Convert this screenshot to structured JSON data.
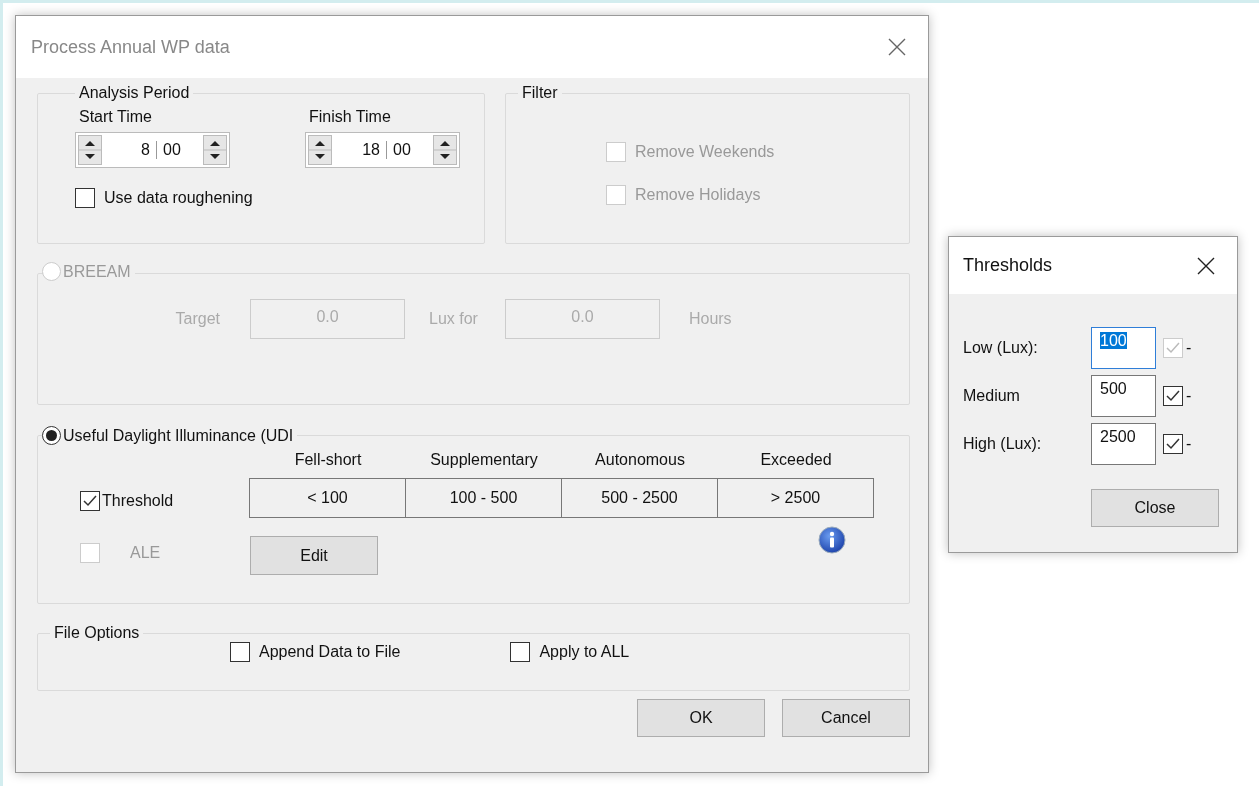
{
  "main_window": {
    "title": "Process Annual WP data"
  },
  "analysis_period": {
    "title": "Analysis Period",
    "times": [
      {
        "label": "Start Time",
        "hours": "8",
        "minutes": "00"
      },
      {
        "label": "Finish Time",
        "hours": "18",
        "minutes": "00"
      }
    ],
    "roughening": {
      "label": "Use data roughening",
      "checked": false
    }
  },
  "filter": {
    "title": "Filter",
    "options": [
      {
        "label": "Remove Weekends",
        "checked": false,
        "disabled": true
      },
      {
        "label": "Remove Holidays",
        "checked": false,
        "disabled": true
      }
    ]
  },
  "breeam": {
    "label": "BREEAM",
    "selected": false,
    "disabled": true,
    "target_label": "Target",
    "target_value": "0.0",
    "lux_label": "Lux for",
    "hours_value": "0.0",
    "hours_label": "Hours"
  },
  "udi": {
    "label": "Useful Daylight Illuminance (UDI",
    "selected": true,
    "threshold": {
      "label": "Threshold",
      "checked": true,
      "disabled": false
    },
    "ale": {
      "label": "ALE",
      "checked": false,
      "disabled": true
    },
    "bands": [
      {
        "name": "Fell-short",
        "range": "< 100"
      },
      {
        "name": "Supplementary",
        "range": "100 - 500"
      },
      {
        "name": "Autonomous",
        "range": "500 - 2500"
      },
      {
        "name": "Exceeded",
        "range": "> 2500"
      }
    ],
    "edit_button": "Edit"
  },
  "file_options": {
    "title": "File Options",
    "options": [
      {
        "label": "Append Data to File",
        "checked": false
      },
      {
        "label": "Apply to ALL",
        "checked": false
      }
    ]
  },
  "buttons": [
    "OK",
    "Cancel"
  ],
  "thresholds_window": {
    "title": "Thresholds",
    "rows": [
      {
        "label": "Low (Lux):",
        "value": "100",
        "focused": true,
        "checked": true,
        "disabled": true,
        "suffix": "-"
      },
      {
        "label": "Medium",
        "value": "500",
        "focused": false,
        "checked": true,
        "disabled": false,
        "suffix": "-"
      },
      {
        "label": "High (Lux):",
        "value": "2500",
        "focused": false,
        "checked": true,
        "disabled": false,
        "suffix": "-"
      }
    ],
    "close_button": "Close"
  }
}
